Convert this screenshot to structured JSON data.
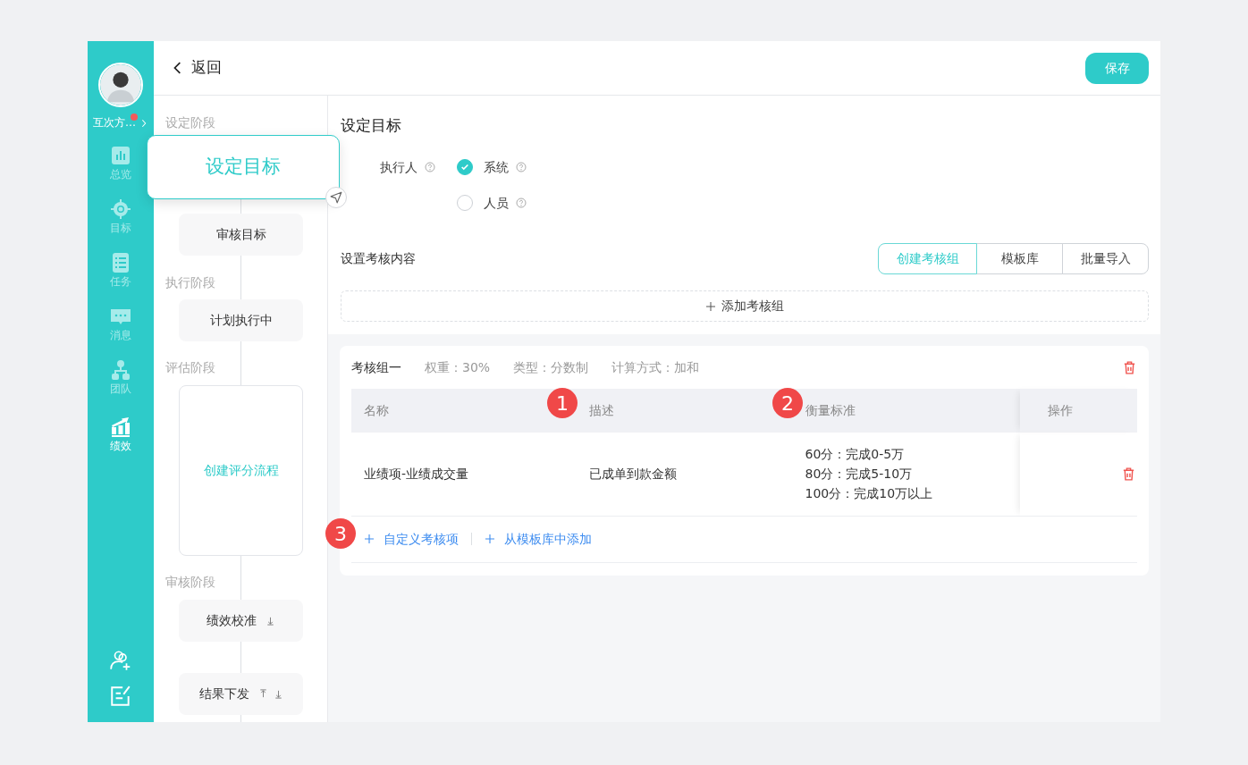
{
  "sidebar": {
    "user_name": "互次方…",
    "notification": true,
    "items": [
      {
        "label": "总览",
        "kind": "overview",
        "selected": false
      },
      {
        "label": "目标",
        "kind": "target",
        "selected": false
      },
      {
        "label": "任务",
        "kind": "task",
        "selected": false
      },
      {
        "label": "消息",
        "kind": "message",
        "selected": false
      },
      {
        "label": "团队",
        "kind": "team",
        "selected": false
      },
      {
        "label": "绩效",
        "kind": "performance",
        "selected": true
      }
    ]
  },
  "header": {
    "back": "返回",
    "save": "保存"
  },
  "flow": [
    {
      "stage": "设定阶段",
      "steps": [
        {
          "label": "设定目标",
          "kind": "step",
          "selected": true
        },
        {
          "label": "审核目标",
          "kind": "step",
          "selected": false
        }
      ]
    },
    {
      "stage": "执行阶段",
      "steps": [
        {
          "label": "计划执行中",
          "kind": "step",
          "selected": false
        }
      ]
    },
    {
      "stage": "评估阶段",
      "steps": [
        {
          "label": "创建评分流程",
          "kind": "create",
          "selected": false
        }
      ]
    },
    {
      "stage": "审核阶段",
      "steps": [
        {
          "label": "绩效校准",
          "kind": "sortable-down",
          "selected": false
        },
        {
          "label": "结果下发",
          "kind": "sortable-both",
          "selected": false
        }
      ]
    }
  ],
  "main": {
    "title": "设定目标",
    "executor_label": "执行人",
    "executor_options": [
      {
        "label": "系统",
        "selected": true
      },
      {
        "label": "人员",
        "selected": false
      }
    ],
    "content_label": "设置考核内容",
    "tabs": [
      {
        "label": "创建考核组",
        "selected": true
      },
      {
        "label": "模板库",
        "selected": false
      },
      {
        "label": "批量导入",
        "selected": false
      }
    ],
    "add_group": "添加考核组",
    "group": {
      "name": "考核组一",
      "meta": [
        "权重：30%",
        "类型：分数制",
        "计算方式：加和"
      ],
      "table": {
        "columns": [
          "名称",
          "描述",
          "衡量标准",
          "操作"
        ],
        "rows": [
          {
            "name": "业绩项-业绩成交量",
            "description": "已成单到款金额",
            "criteria": [
              "60分：完成0-5万",
              "80分：完成5-10万",
              "100分：完成10万以上"
            ]
          }
        ]
      },
      "actions": [
        "自定义考核项",
        "从模板库中添加"
      ]
    }
  },
  "annotations": [
    "1",
    "2",
    "3"
  ]
}
